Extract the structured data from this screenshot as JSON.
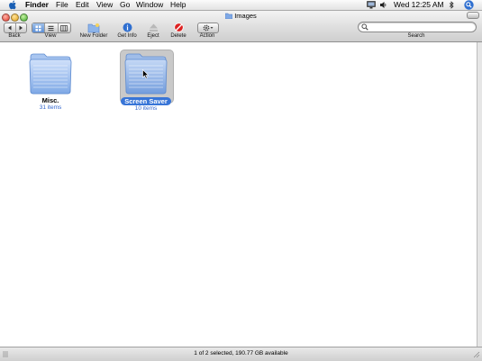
{
  "menubar": {
    "items": [
      {
        "label": "Finder",
        "bold": true
      },
      {
        "label": "File"
      },
      {
        "label": "Edit"
      },
      {
        "label": "View"
      },
      {
        "label": "Go"
      },
      {
        "label": "Window"
      },
      {
        "label": "Help"
      }
    ],
    "clock": "Wed 12:25 AM"
  },
  "window": {
    "title": "Images"
  },
  "toolbar": {
    "back_label": "Back",
    "view_label": "View",
    "new_folder_label": "New Folder",
    "get_info_label": "Get Info",
    "eject_label": "Eject",
    "delete_label": "Delete",
    "action_label": "Action",
    "search_label": "Search",
    "search_value": ""
  },
  "items": [
    {
      "name": "Misc.",
      "count": "31 items",
      "selected": false
    },
    {
      "name": "Screen Saver",
      "count": "10 items",
      "selected": true
    }
  ],
  "status": {
    "text": "1 of 2 selected, 190.77 GB available"
  },
  "colors": {
    "selection": "#3875d7",
    "count_text": "#3366cc",
    "folder_blue": "#7fa9e6"
  }
}
